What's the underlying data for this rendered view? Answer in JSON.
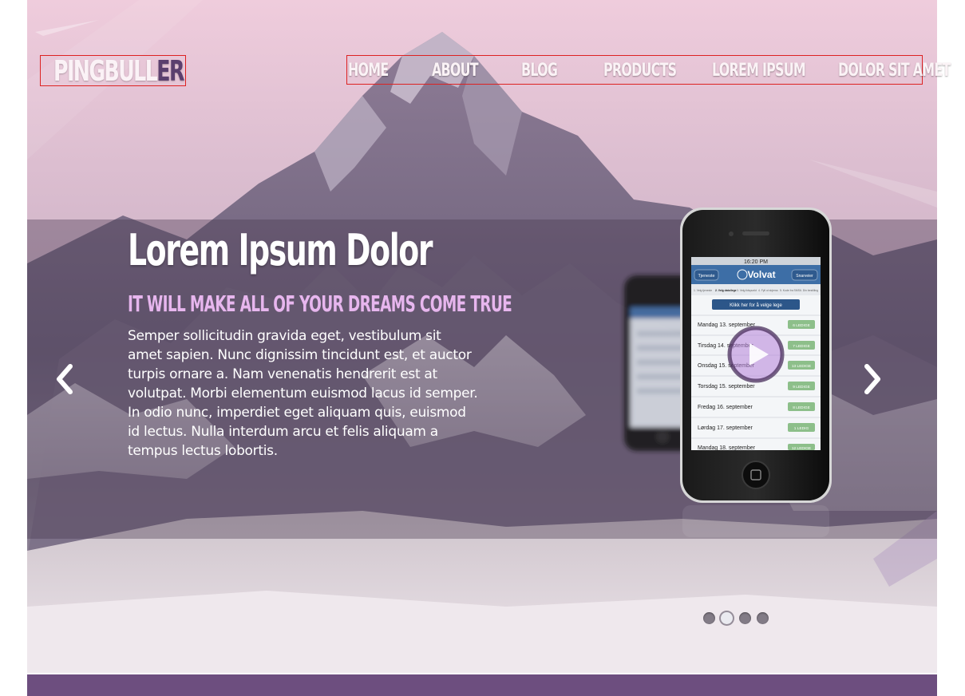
{
  "brand": {
    "logo_main": "PINGBULL",
    "logo_accent": "ER"
  },
  "nav": {
    "items": [
      {
        "label": "HOME"
      },
      {
        "label": "ABOUT"
      },
      {
        "label": "BLOG"
      },
      {
        "label": "PRODUCTS"
      },
      {
        "label": "LOREM IPSUM"
      },
      {
        "label": "DOLOR SIT AMET"
      }
    ]
  },
  "slide": {
    "headline": "Lorem Ipsum Dolor",
    "subheadline": "IT WILL MAKE ALL OF YOUR DREAMS COME TRUE",
    "body": "Semper sollicitudin gravida eget, vestibulum sit amet sapien. Nunc dignissim tincidunt est, et auctor turpis ornare a. Nam venenatis hendrerit est at volutpat. Morbi elementum euismod lacus id semper. In odio nunc, imperdiet eget aliquam quis, euismod id lectus. Nulla interdum arcu et felis aliquam a tempus lectus lobortis."
  },
  "carousel": {
    "dots": 4,
    "active_dot": 2
  },
  "phone_screen": {
    "time": "16:20 PM",
    "back_btn": "Tjeneste",
    "app_name": "Volvat",
    "next_btn": "Snarveier",
    "steps": [
      "1. Velg tjeneste",
      "2. Velg dato/lege",
      "3. Velg tidspunkt",
      "4. Fyll ut skjema",
      "5. Kode fra SMS",
      "6. Din bestilling"
    ],
    "select_btn": "Klikk her for å velge lege",
    "rows": [
      {
        "day": "Mandag 13. september",
        "badge": "6 LEDIGE"
      },
      {
        "day": "Tirsdag 14. september",
        "badge": "7 LEDIGE"
      },
      {
        "day": "Onsdag 15. september",
        "badge": "13 LEDIGE"
      },
      {
        "day": "Torsdag 15. september",
        "badge": "9 LEDIGE"
      },
      {
        "day": "Fredag 16. september",
        "badge": "8 LEDIGE"
      },
      {
        "day": "Lørdag 17. september",
        "badge": "1 LEDIG"
      },
      {
        "day": "Mandag 18. september",
        "badge": "12 LEDIGE"
      }
    ]
  },
  "colors": {
    "brand_purple": "#6d4e7f",
    "subhead_pink": "#e7b6ee",
    "badge_green": "#8dbf8a",
    "play_purple": "#b582d9"
  }
}
